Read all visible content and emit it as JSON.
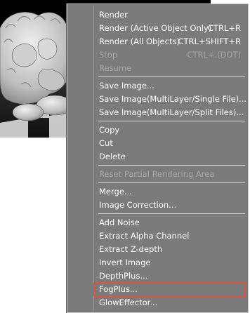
{
  "menu": {
    "groups": [
      [
        {
          "label": "Render",
          "shortcut": "",
          "disabled": false
        },
        {
          "label": "Render (Active Object Only)",
          "shortcut": "CTRL+R",
          "disabled": false
        },
        {
          "label": "Render (All Objects)",
          "shortcut": "CTRL+SHIFT+R",
          "disabled": false
        },
        {
          "label": "Stop",
          "shortcut": "CTRL+.(DOT)",
          "disabled": true
        },
        {
          "label": "Resume",
          "shortcut": "",
          "disabled": true
        }
      ],
      [
        {
          "label": "Save Image...",
          "shortcut": "",
          "disabled": false
        },
        {
          "label": "Save Image(MultiLayer/Single File)...",
          "shortcut": "",
          "disabled": false
        },
        {
          "label": "Save Image(MultiLayer/Split Files)...",
          "shortcut": "",
          "disabled": false
        }
      ],
      [
        {
          "label": "Copy",
          "shortcut": "",
          "disabled": false
        },
        {
          "label": "Cut",
          "shortcut": "",
          "disabled": false
        },
        {
          "label": "Delete",
          "shortcut": "",
          "disabled": false
        }
      ],
      [
        {
          "label": "Reset Partial Rendering Area",
          "shortcut": "",
          "disabled": true
        }
      ],
      [
        {
          "label": "Merge...",
          "shortcut": "",
          "disabled": false
        },
        {
          "label": "Image Correction...",
          "shortcut": "",
          "disabled": false
        }
      ],
      [
        {
          "label": "Add Noise",
          "shortcut": "",
          "disabled": false
        },
        {
          "label": "Extract Alpha Channel",
          "shortcut": "",
          "disabled": false
        },
        {
          "label": "Extract Z-depth",
          "shortcut": "",
          "disabled": false
        },
        {
          "label": "Invert Image",
          "shortcut": "",
          "disabled": false
        },
        {
          "label": "DepthPlus...",
          "shortcut": "",
          "disabled": false
        },
        {
          "label": "FogPlus...",
          "shortcut": "",
          "disabled": false,
          "highlighted": true
        },
        {
          "label": "GlowEffector...",
          "shortcut": "",
          "disabled": false
        }
      ]
    ]
  },
  "colors": {
    "menu_bg": "#7b7b7b",
    "menu_text": "#ffffff",
    "disabled_text": "#a6a6a6",
    "highlight_border": "#e0533f"
  }
}
